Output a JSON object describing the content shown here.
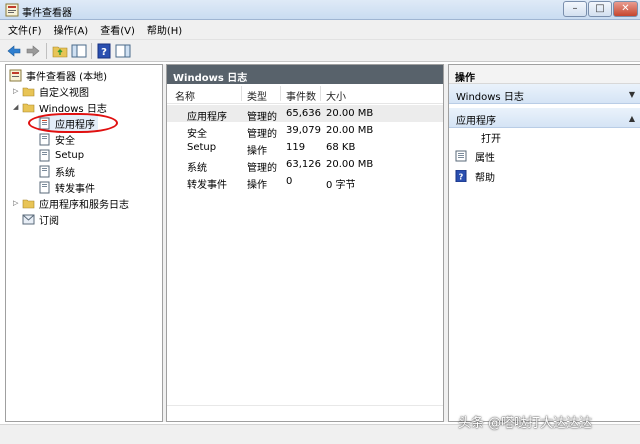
{
  "window": {
    "title": "事件查看器",
    "minimize": "–",
    "maximize": "□",
    "close": "✕"
  },
  "menu": [
    "文件(F)",
    "操作(A)",
    "查看(V)",
    "帮助(H)"
  ],
  "tree": {
    "root": "事件查看器 (本地)",
    "custom_views": "自定义视图",
    "windows_logs": "Windows 日志",
    "logs": [
      "应用程序",
      "安全",
      "Setup",
      "系统",
      "转发事件"
    ],
    "app_service_logs": "应用程序和服务日志",
    "subscriptions": "订阅"
  },
  "center": {
    "title": "Windows 日志",
    "columns": [
      "名称",
      "类型",
      "事件数",
      "大小"
    ],
    "rows": [
      {
        "name": "应用程序",
        "type": "管理的",
        "count": "65,636",
        "size": "20.00 MB"
      },
      {
        "name": "安全",
        "type": "管理的",
        "count": "39,079",
        "size": "20.00 MB"
      },
      {
        "name": "Setup",
        "type": "操作",
        "count": "119",
        "size": "68 KB"
      },
      {
        "name": "系统",
        "type": "管理的",
        "count": "63,126",
        "size": "20.00 MB"
      },
      {
        "name": "转发事件",
        "type": "操作",
        "count": "0",
        "size": "0 字节"
      }
    ]
  },
  "actions": {
    "title": "操作",
    "section1": "Windows 日志",
    "section2": "应用程序",
    "items": [
      "打开",
      "属性",
      "帮助"
    ]
  },
  "watermark": "头条 @嗒哒打大达达达",
  "colors": {
    "highlight_circle": "#e01010",
    "center_header_bg": "#58626b",
    "selection_bg": "#e3edf8"
  }
}
